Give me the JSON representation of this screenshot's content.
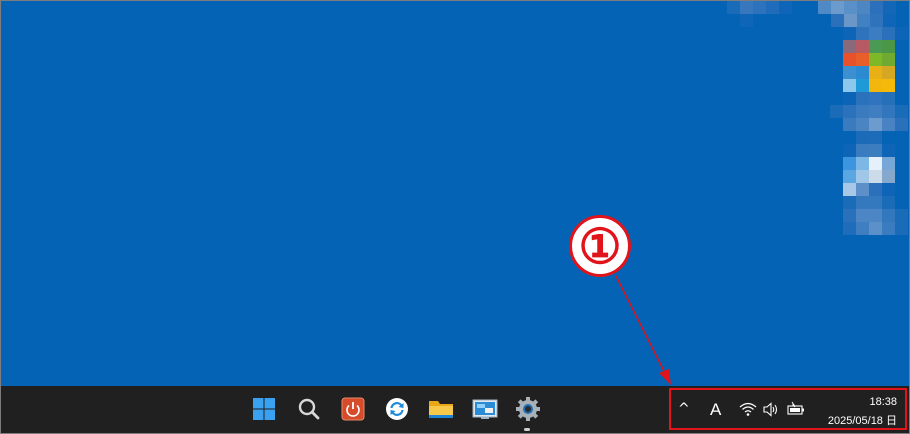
{
  "annotation": {
    "marker": "①"
  },
  "taskbar": {
    "icons": [
      {
        "name": "start-icon"
      },
      {
        "name": "search-icon"
      },
      {
        "name": "power-app-icon"
      },
      {
        "name": "sync-icon"
      },
      {
        "name": "file-explorer-icon"
      },
      {
        "name": "control-panel-icon"
      },
      {
        "name": "settings-icon"
      }
    ]
  },
  "tray": {
    "chevron": "^",
    "ime": "A",
    "time": "18:38",
    "date": "2025/05/18 日"
  },
  "colors": {
    "desktop": "#0563b5",
    "taskbar": "#202020",
    "annotation": "#e0141a"
  }
}
